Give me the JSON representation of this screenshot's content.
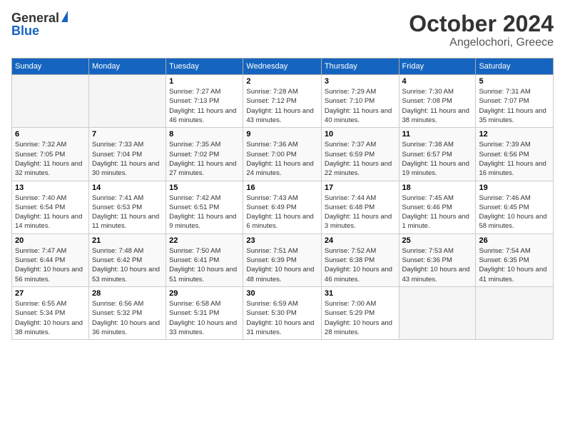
{
  "header": {
    "logo_general": "General",
    "logo_blue": "Blue",
    "month": "October 2024",
    "location": "Angelochori, Greece"
  },
  "weekdays": [
    "Sunday",
    "Monday",
    "Tuesday",
    "Wednesday",
    "Thursday",
    "Friday",
    "Saturday"
  ],
  "weeks": [
    [
      {
        "day": "",
        "sunrise": "",
        "sunset": "",
        "daylight": ""
      },
      {
        "day": "",
        "sunrise": "",
        "sunset": "",
        "daylight": ""
      },
      {
        "day": "1",
        "sunrise": "Sunrise: 7:27 AM",
        "sunset": "Sunset: 7:13 PM",
        "daylight": "Daylight: 11 hours and 46 minutes."
      },
      {
        "day": "2",
        "sunrise": "Sunrise: 7:28 AM",
        "sunset": "Sunset: 7:12 PM",
        "daylight": "Daylight: 11 hours and 43 minutes."
      },
      {
        "day": "3",
        "sunrise": "Sunrise: 7:29 AM",
        "sunset": "Sunset: 7:10 PM",
        "daylight": "Daylight: 11 hours and 40 minutes."
      },
      {
        "day": "4",
        "sunrise": "Sunrise: 7:30 AM",
        "sunset": "Sunset: 7:08 PM",
        "daylight": "Daylight: 11 hours and 38 minutes."
      },
      {
        "day": "5",
        "sunrise": "Sunrise: 7:31 AM",
        "sunset": "Sunset: 7:07 PM",
        "daylight": "Daylight: 11 hours and 35 minutes."
      }
    ],
    [
      {
        "day": "6",
        "sunrise": "Sunrise: 7:32 AM",
        "sunset": "Sunset: 7:05 PM",
        "daylight": "Daylight: 11 hours and 32 minutes."
      },
      {
        "day": "7",
        "sunrise": "Sunrise: 7:33 AM",
        "sunset": "Sunset: 7:04 PM",
        "daylight": "Daylight: 11 hours and 30 minutes."
      },
      {
        "day": "8",
        "sunrise": "Sunrise: 7:35 AM",
        "sunset": "Sunset: 7:02 PM",
        "daylight": "Daylight: 11 hours and 27 minutes."
      },
      {
        "day": "9",
        "sunrise": "Sunrise: 7:36 AM",
        "sunset": "Sunset: 7:00 PM",
        "daylight": "Daylight: 11 hours and 24 minutes."
      },
      {
        "day": "10",
        "sunrise": "Sunrise: 7:37 AM",
        "sunset": "Sunset: 6:59 PM",
        "daylight": "Daylight: 11 hours and 22 minutes."
      },
      {
        "day": "11",
        "sunrise": "Sunrise: 7:38 AM",
        "sunset": "Sunset: 6:57 PM",
        "daylight": "Daylight: 11 hours and 19 minutes."
      },
      {
        "day": "12",
        "sunrise": "Sunrise: 7:39 AM",
        "sunset": "Sunset: 6:56 PM",
        "daylight": "Daylight: 11 hours and 16 minutes."
      }
    ],
    [
      {
        "day": "13",
        "sunrise": "Sunrise: 7:40 AM",
        "sunset": "Sunset: 6:54 PM",
        "daylight": "Daylight: 11 hours and 14 minutes."
      },
      {
        "day": "14",
        "sunrise": "Sunrise: 7:41 AM",
        "sunset": "Sunset: 6:53 PM",
        "daylight": "Daylight: 11 hours and 11 minutes."
      },
      {
        "day": "15",
        "sunrise": "Sunrise: 7:42 AM",
        "sunset": "Sunset: 6:51 PM",
        "daylight": "Daylight: 11 hours and 9 minutes."
      },
      {
        "day": "16",
        "sunrise": "Sunrise: 7:43 AM",
        "sunset": "Sunset: 6:49 PM",
        "daylight": "Daylight: 11 hours and 6 minutes."
      },
      {
        "day": "17",
        "sunrise": "Sunrise: 7:44 AM",
        "sunset": "Sunset: 6:48 PM",
        "daylight": "Daylight: 11 hours and 3 minutes."
      },
      {
        "day": "18",
        "sunrise": "Sunrise: 7:45 AM",
        "sunset": "Sunset: 6:46 PM",
        "daylight": "Daylight: 11 hours and 1 minute."
      },
      {
        "day": "19",
        "sunrise": "Sunrise: 7:46 AM",
        "sunset": "Sunset: 6:45 PM",
        "daylight": "Daylight: 10 hours and 58 minutes."
      }
    ],
    [
      {
        "day": "20",
        "sunrise": "Sunrise: 7:47 AM",
        "sunset": "Sunset: 6:44 PM",
        "daylight": "Daylight: 10 hours and 56 minutes."
      },
      {
        "day": "21",
        "sunrise": "Sunrise: 7:48 AM",
        "sunset": "Sunset: 6:42 PM",
        "daylight": "Daylight: 10 hours and 53 minutes."
      },
      {
        "day": "22",
        "sunrise": "Sunrise: 7:50 AM",
        "sunset": "Sunset: 6:41 PM",
        "daylight": "Daylight: 10 hours and 51 minutes."
      },
      {
        "day": "23",
        "sunrise": "Sunrise: 7:51 AM",
        "sunset": "Sunset: 6:39 PM",
        "daylight": "Daylight: 10 hours and 48 minutes."
      },
      {
        "day": "24",
        "sunrise": "Sunrise: 7:52 AM",
        "sunset": "Sunset: 6:38 PM",
        "daylight": "Daylight: 10 hours and 46 minutes."
      },
      {
        "day": "25",
        "sunrise": "Sunrise: 7:53 AM",
        "sunset": "Sunset: 6:36 PM",
        "daylight": "Daylight: 10 hours and 43 minutes."
      },
      {
        "day": "26",
        "sunrise": "Sunrise: 7:54 AM",
        "sunset": "Sunset: 6:35 PM",
        "daylight": "Daylight: 10 hours and 41 minutes."
      }
    ],
    [
      {
        "day": "27",
        "sunrise": "Sunrise: 6:55 AM",
        "sunset": "Sunset: 5:34 PM",
        "daylight": "Daylight: 10 hours and 38 minutes."
      },
      {
        "day": "28",
        "sunrise": "Sunrise: 6:56 AM",
        "sunset": "Sunset: 5:32 PM",
        "daylight": "Daylight: 10 hours and 36 minutes."
      },
      {
        "day": "29",
        "sunrise": "Sunrise: 6:58 AM",
        "sunset": "Sunset: 5:31 PM",
        "daylight": "Daylight: 10 hours and 33 minutes."
      },
      {
        "day": "30",
        "sunrise": "Sunrise: 6:59 AM",
        "sunset": "Sunset: 5:30 PM",
        "daylight": "Daylight: 10 hours and 31 minutes."
      },
      {
        "day": "31",
        "sunrise": "Sunrise: 7:00 AM",
        "sunset": "Sunset: 5:29 PM",
        "daylight": "Daylight: 10 hours and 28 minutes."
      },
      {
        "day": "",
        "sunrise": "",
        "sunset": "",
        "daylight": ""
      },
      {
        "day": "",
        "sunrise": "",
        "sunset": "",
        "daylight": ""
      }
    ]
  ]
}
